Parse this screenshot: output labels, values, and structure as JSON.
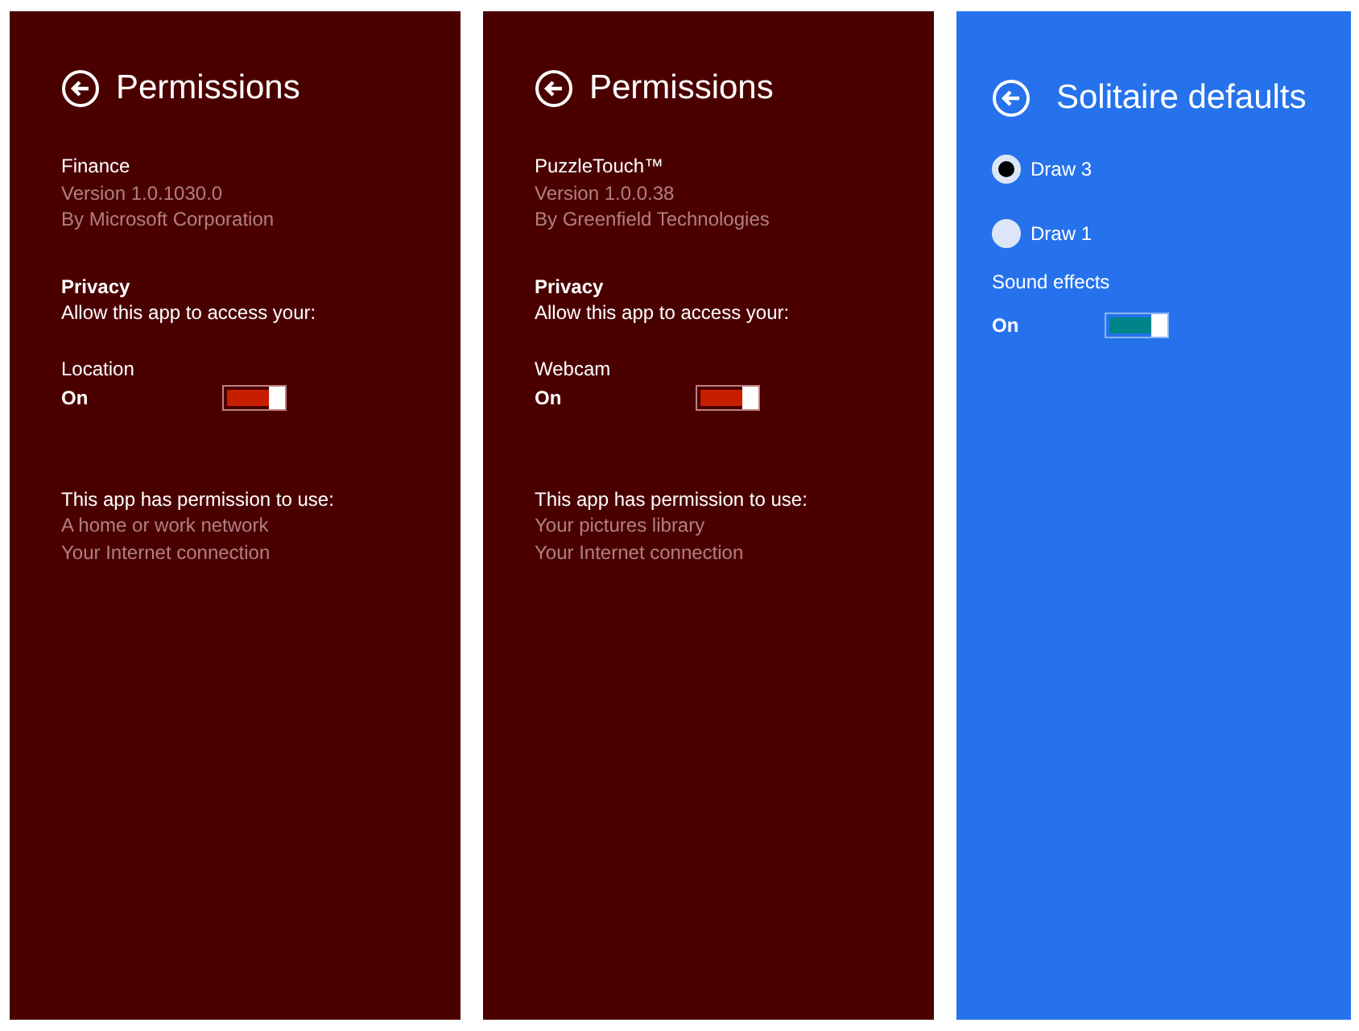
{
  "panels": [
    {
      "kind": "permissions",
      "title": "Permissions",
      "app": {
        "name": "Finance",
        "version": "Version 1.0.1030.0",
        "publisher": "By Microsoft Corporation"
      },
      "privacy": {
        "heading": "Privacy",
        "intro": "Allow this app to access your:",
        "setting": "Location",
        "state_label": "On",
        "on": true
      },
      "permissions": {
        "heading": "This app has permission to use:",
        "items": [
          "A home or work network",
          "Your Internet connection"
        ]
      }
    },
    {
      "kind": "permissions",
      "title": "Permissions",
      "app": {
        "name": "PuzzleTouch™",
        "version": "Version 1.0.0.38",
        "publisher": "By Greenfield Technologies"
      },
      "privacy": {
        "heading": "Privacy",
        "intro": "Allow this app to access your:",
        "setting": "Webcam",
        "state_label": "On",
        "on": true
      },
      "permissions": {
        "heading": "This app has permission to use:",
        "items": [
          "Your pictures library",
          "Your Internet connection"
        ]
      }
    },
    {
      "kind": "settings",
      "title": "Solitaire defaults",
      "options": [
        {
          "label": "Draw 3",
          "selected": true
        },
        {
          "label": "Draw 1",
          "selected": false
        }
      ],
      "sound": {
        "label": "Sound effects",
        "state_label": "On",
        "on": true
      }
    }
  ]
}
